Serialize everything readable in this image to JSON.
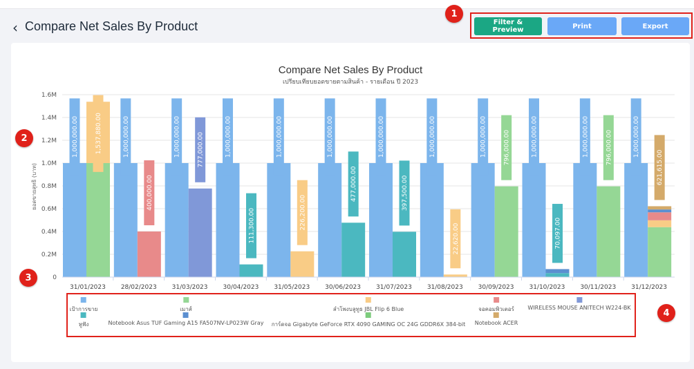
{
  "page": {
    "title": "Compare Net Sales By Product",
    "back_icon": "‹"
  },
  "toolbar": {
    "filter_label": "Filter & Preview",
    "print_label": "Print",
    "export_label": "Export"
  },
  "markers": [
    "1",
    "2",
    "3",
    "4"
  ],
  "colors": {
    "accent_green": "#1ba784",
    "button_blue": "#6aa8f7",
    "highlight_red": "#e0211a"
  },
  "chart_data": {
    "type": "bar",
    "title": "Compare Net Sales By Product",
    "subtitle": "เปรียบเทียบยอดขายตามสินค้า - รายเดือน ปี 2023",
    "xlabel": "",
    "ylabel": "ยอดขายสุทธิ (บาท)",
    "ylim": [
      0,
      1600000
    ],
    "yticks": [
      "0",
      "0.2M",
      "0.4M",
      "0.6M",
      "0.8M",
      "1.0M",
      "1.2M",
      "1.4M",
      "1.6M"
    ],
    "grid": true,
    "legend_position": "bottom",
    "categories": [
      "31/01/2023",
      "28/02/2023",
      "31/03/2023",
      "30/04/2023",
      "31/05/2023",
      "30/06/2023",
      "31/07/2023",
      "31/08/2023",
      "30/09/2023",
      "31/10/2023",
      "30/11/2023",
      "31/12/2023"
    ],
    "target_series": {
      "name": "เป้าการขาย",
      "color": "#7cb5ec",
      "values": [
        1000000,
        1000000,
        1000000,
        1000000,
        1000000,
        1000000,
        1000000,
        1000000,
        1000000,
        1000000,
        1000000,
        1000000
      ],
      "labels": [
        "1,000,000.00",
        "1,000,000.00",
        "1,000,000.00",
        "1,000,000.00",
        "1,000,000.00",
        "1,000,000.00",
        "1,000,000.00",
        "1,000,000.00",
        "1,000,000.00",
        "1,000,000.00",
        "1,000,000.00",
        "1,000,000.00"
      ]
    },
    "series": [
      {
        "name": "เมาส์",
        "color": "#95d795",
        "values": [
          1000000,
          0,
          0,
          0,
          0,
          0,
          0,
          0,
          796000,
          0,
          796000,
          438000
        ]
      },
      {
        "name": "ลำโพงบลูทูธ JBL Flip 6 Blue",
        "color": "#f9cc86",
        "values": [
          537880,
          0,
          0,
          0,
          226200,
          0,
          0,
          22620,
          0,
          0,
          0,
          60000
        ]
      },
      {
        "name": "จอคอมพิวเตอร์",
        "color": "#e88a8a",
        "values": [
          0,
          400000,
          0,
          0,
          0,
          0,
          0,
          0,
          0,
          0,
          0,
          70000
        ]
      },
      {
        "name": "WIRELESS MOUSE ANITECH W224-BK",
        "color": "#8098d8",
        "values": [
          0,
          0,
          777000,
          0,
          0,
          0,
          0,
          0,
          0,
          0,
          0,
          0
        ]
      },
      {
        "name": "หูฟัง",
        "color": "#4bb8c0",
        "values": [
          0,
          0,
          0,
          111300,
          0,
          477000,
          397500,
          0,
          0,
          35000,
          0,
          0
        ]
      },
      {
        "name": "Notebook Asus TUF Gaming A15 FA507NV-LP023W Gray",
        "color": "#5b8fd0",
        "values": [
          0,
          0,
          0,
          0,
          0,
          0,
          0,
          0,
          0,
          35097,
          0,
          25000
        ]
      },
      {
        "name": "การ์ดจอ Gigabyte GeForce RTX 4090 GAMING OC 24G GDDR6X 384-bit",
        "color": "#7dcc7d",
        "values": [
          0,
          0,
          0,
          0,
          0,
          0,
          0,
          0,
          0,
          0,
          0,
          0
        ]
      },
      {
        "name": "Notebook ACER",
        "color": "#d4aa6a",
        "values": [
          0,
          0,
          0,
          0,
          0,
          0,
          0,
          0,
          0,
          0,
          0,
          28615
        ]
      }
    ],
    "total_labels": [
      "1,537,880.00",
      "400,000.00",
      "777,000.00",
      "111,300.00",
      "226,200.00",
      "477,000.00",
      "397,500.00",
      "22,620.00",
      "796,000.00",
      "70,097.00",
      "796,000.00",
      "621,615.00"
    ],
    "total_label_colors": [
      "#f9cc86",
      "#e88a8a",
      "#8098d8",
      "#4bb8c0",
      "#f9cc86",
      "#4bb8c0",
      "#4bb8c0",
      "#f9cc86",
      "#95d795",
      "#4bb8c0",
      "#95d795",
      "#d4aa6a"
    ]
  }
}
